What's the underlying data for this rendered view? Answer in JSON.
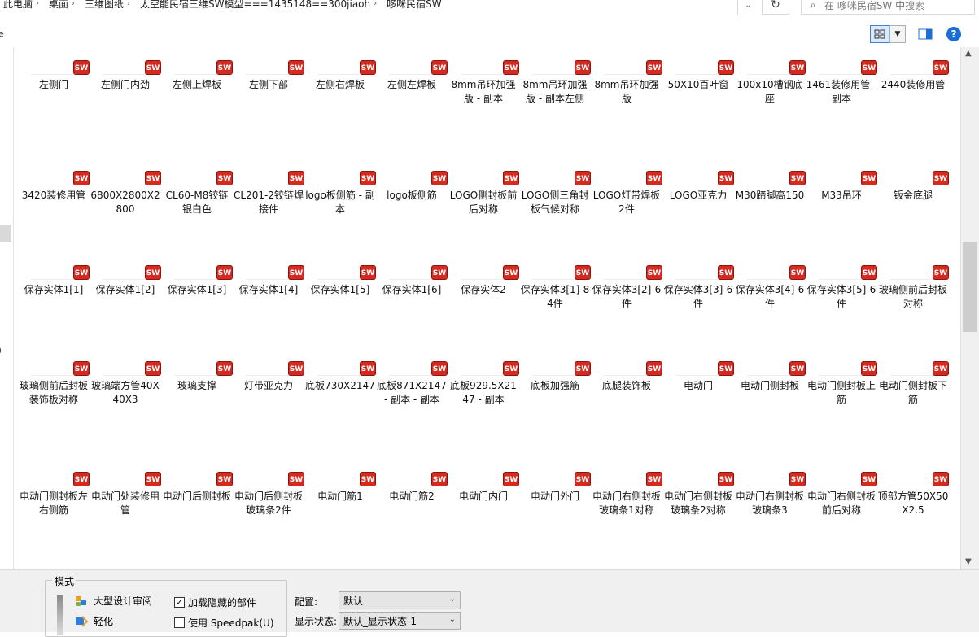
{
  "address": {
    "crumbs": [
      "此电脑",
      "桌面",
      "三维图纸",
      "太空能民宿三维SW模型===1435148==300jiaoh",
      "哆咪民宿SW"
    ],
    "search_placeholder": "在 哆咪民宿SW 中搜索"
  },
  "toolbar": {
    "left_fragment": "e"
  },
  "leftpane": {
    "fragment": ")"
  },
  "badge": "SW",
  "rows": [
    [
      "左侧门",
      "左侧门内劲",
      "左侧上焊板",
      "左侧下部",
      "左侧右焊板",
      "左侧左焊板",
      "8mm吊环加强版 - 副本",
      "8mm吊环加强版 - 副本左侧",
      "8mm吊环加强版",
      "50X10百叶窗",
      "100x10槽钢底座",
      "1461装修用管 - 副本",
      "2440装修用管"
    ],
    [
      "3420装修用管",
      "6800X2800X2800",
      "CL60-M8铰链银白色",
      "CL201-2铰链焊接件",
      "logo板侧筋 - 副本",
      "logo板侧筋",
      "LOGO侧封板前后对称",
      "LOGO侧三角封板气候对称",
      "LOGO灯带焊板2件",
      "LOGO亚克力",
      "M30蹄脚高150",
      "M33吊环",
      "钣金底腿"
    ],
    [
      "保存实体1[1]",
      "保存实体1[2]",
      "保存实体1[3]",
      "保存实体1[4]",
      "保存实体1[5]",
      "保存实体1[6]",
      "保存实体2",
      "保存实体3[1]-84件",
      "保存实体3[2]-6件",
      "保存实体3[3]-6件",
      "保存实体3[4]-6件",
      "保存实体3[5]-6件",
      "玻璃侧前后封板对称"
    ],
    [
      "玻璃侧前后封板装饰板对称",
      "玻璃端方管40X40X3",
      "玻璃支撑",
      "灯带亚克力",
      "底板730X2147",
      "底板871X2147 - 副本 - 副本",
      "底板929.5X2147 - 副本",
      "底板加强筋",
      "底腿装饰板",
      "电动门",
      "电动门侧封板",
      "电动门侧封板上筋",
      "电动门侧封板下筋"
    ],
    [
      "电动门侧封板左右侧筋",
      "电动门处装修用管",
      "电动门后侧封板",
      "电动门后侧封板玻璃条2件",
      "电动门筋1",
      "电动门筋2",
      "电动门内门",
      "电动门外门",
      "电动门右侧封板玻璃条1对称",
      "电动门右侧封板玻璃条2对称",
      "电动门右侧封板玻璃条3",
      "电动门右侧封板前后对称",
      "顶部方管50X50X2.5"
    ]
  ],
  "bottom": {
    "group_title": "模式",
    "opt_large": "大型设计审阅",
    "opt_light": "轻化",
    "cb_hidden": "加载隐藏的部件",
    "cb_hidden_checked": "✓",
    "cb_speedpak": "使用 Speedpak(U)",
    "config_label": "配置:",
    "config_value": "默认",
    "display_label": "显示状态:",
    "display_value": "默认_显示状态-1"
  }
}
